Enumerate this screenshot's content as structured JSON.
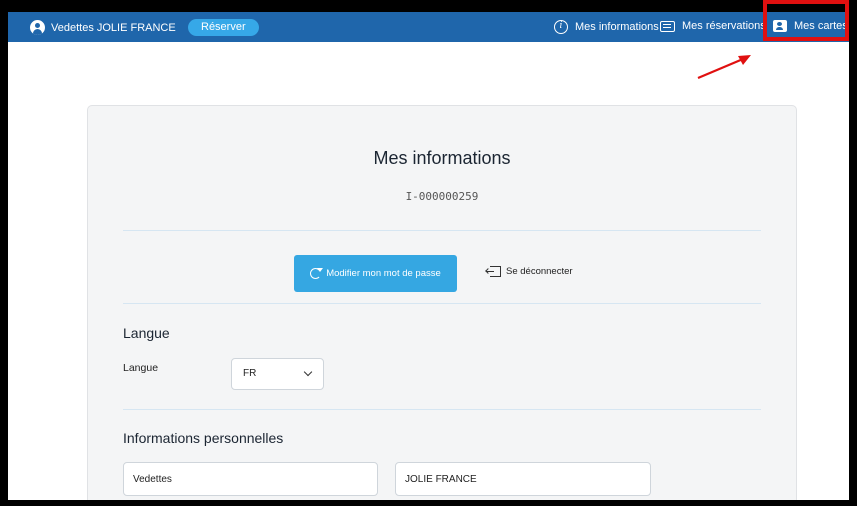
{
  "header": {
    "brand": "Vedettes JOLIE FRANCE",
    "reserve_label": "Réserver",
    "nav": [
      {
        "label": "Mes informations",
        "icon": "info-icon"
      },
      {
        "label": "Mes réservations",
        "icon": "list-icon"
      },
      {
        "label": "Mes cartes",
        "icon": "card-icon"
      }
    ]
  },
  "page": {
    "title": "Mes informations",
    "user_id": "I-000000259",
    "change_password_label": "Modifier mon mot de passe",
    "logout_label": "Se déconnecter"
  },
  "language": {
    "section_title": "Langue",
    "field_label": "Langue",
    "selected": "FR"
  },
  "personal": {
    "section_title": "Informations personnelles",
    "first_name": "Vedettes",
    "last_name": "JOLIE FRANCE"
  },
  "colors": {
    "topbar": "#1f66ab",
    "accent": "#35a7e2",
    "highlight": "#e01010"
  }
}
